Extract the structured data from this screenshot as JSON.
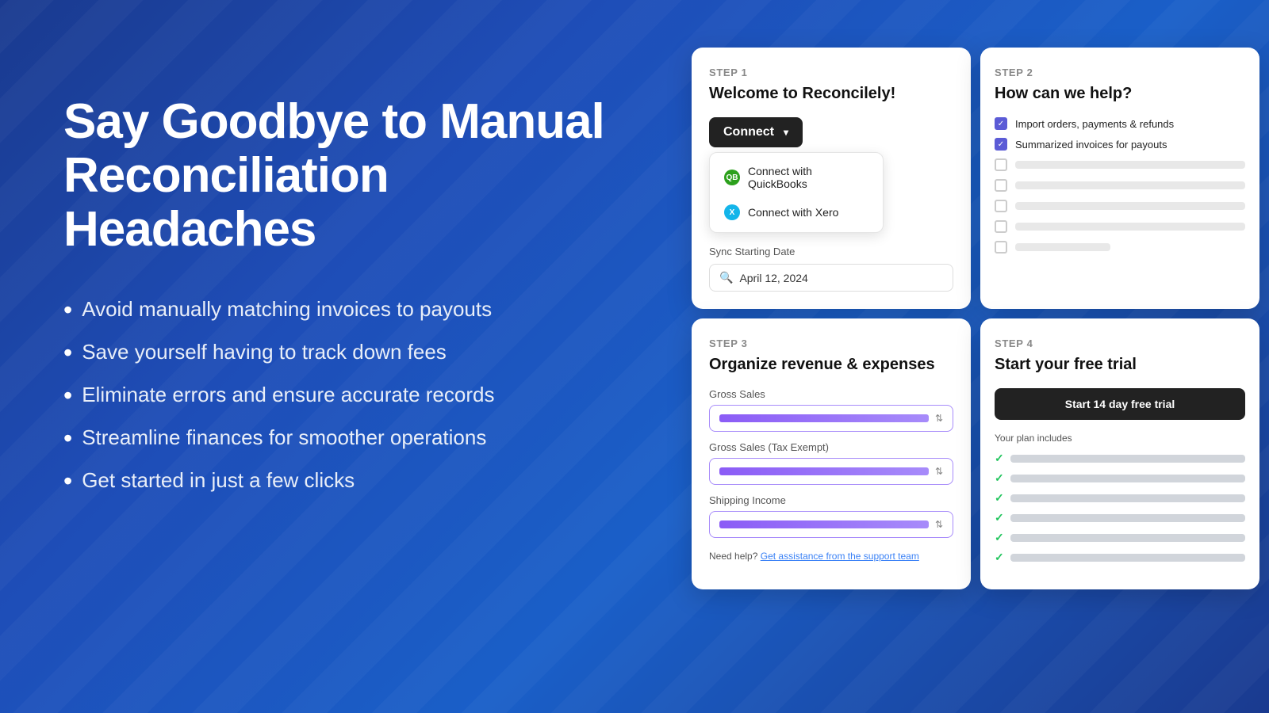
{
  "left": {
    "heading_line1": "Say Goodbye to Manual",
    "heading_line2": "Reconciliation Headaches",
    "bullets": [
      "Avoid manually matching invoices to payouts",
      "Save yourself having to track down fees",
      "Eliminate errors and ensure accurate records",
      "Streamline finances for smoother operations",
      "Get started in just a few clicks"
    ]
  },
  "step1": {
    "step_label": "STEP 1",
    "title": "Welcome to Reconcilely!",
    "connect_btn": "Connect",
    "dropdown_item1": "Connect with QuickBooks",
    "dropdown_item2": "Connect with Xero",
    "sync_label": "Sync Starting Date",
    "sync_date": "April 12, 2024"
  },
  "step2": {
    "step_label": "STEP 2",
    "title": "How can we help?",
    "checked_items": [
      "Import orders, payments & refunds",
      "Summarized invoices for payouts"
    ],
    "unchecked_count": 5
  },
  "step3": {
    "step_label": "STEP 3",
    "title": "Organize revenue & expenses",
    "fields": [
      "Gross Sales",
      "Gross Sales (Tax Exempt)",
      "Shipping Income"
    ],
    "help_text": "Need help?",
    "help_link": "Get assistance from the support team"
  },
  "step4": {
    "step_label": "STEP 4",
    "title": "Start your free trial",
    "trial_btn": "Start 14 day free trial",
    "plan_label": "Your plan includes",
    "plan_items_count": 6
  }
}
